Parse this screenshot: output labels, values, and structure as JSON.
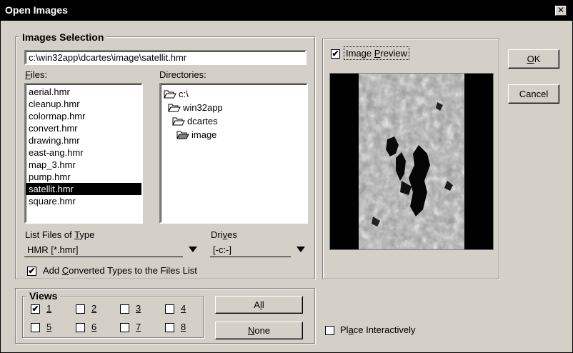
{
  "window": {
    "title": "Open Images",
    "close_glyph": "✕"
  },
  "images_selection": {
    "group_label": "Images Selection",
    "path_value": "c:\\win32app\\dcartes\\image\\satellit.hmr",
    "files_label": "Files:",
    "directories_label": "Directories:",
    "files": [
      "aerial.hmr",
      "cleanup.hmr",
      "colormap.hmr",
      "convert.hmr",
      "drawing.hmr",
      "east-ang.hmr",
      "map_3.hmr",
      "pump.hmr",
      "satellit.hmr",
      "square.hmr"
    ],
    "selected_file": "satellit.hmr",
    "directories": [
      "c:\\",
      "win32app",
      "dcartes",
      "image"
    ],
    "list_type_label": "List Files of Type",
    "list_type_value": "HMR [*.hmr]",
    "drives_label": "Drives",
    "drives_value": "[-c:-]",
    "add_converted_label": "Add Converted Types to the Files List",
    "add_converted_checked": true
  },
  "preview": {
    "label": "Image Preview",
    "checked": true
  },
  "buttons": {
    "ok": "OK",
    "cancel": "Cancel",
    "all": "All",
    "none": "None"
  },
  "views": {
    "group_label": "Views",
    "items": [
      {
        "label": "1",
        "checked": true
      },
      {
        "label": "2",
        "checked": false
      },
      {
        "label": "3",
        "checked": false
      },
      {
        "label": "4",
        "checked": false
      },
      {
        "label": "5",
        "checked": false
      },
      {
        "label": "6",
        "checked": false
      },
      {
        "label": "7",
        "checked": false
      },
      {
        "label": "8",
        "checked": false
      }
    ]
  },
  "place_interactively": {
    "label": "Place Interactively",
    "checked": false
  },
  "icons": {
    "folder": "folder-icon",
    "folder_open": "folder-open-icon",
    "check": "✔"
  }
}
